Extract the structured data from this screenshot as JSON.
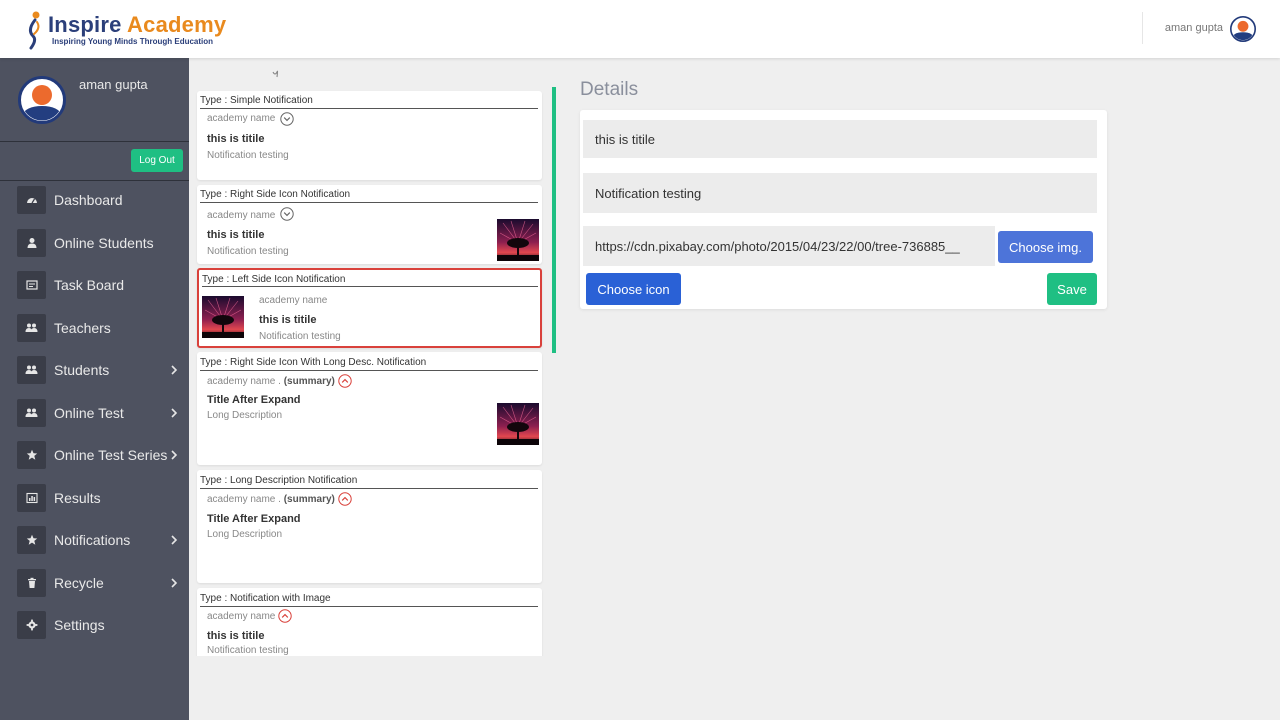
{
  "brand": {
    "name_part1": "Inspire",
    "name_part2": "Academy",
    "tagline": "Inspiring Young Minds Through Education"
  },
  "header": {
    "user_name": "aman gupta"
  },
  "sidebar": {
    "profile_name": "aman gupta",
    "logout_label": "Log Out",
    "items": [
      {
        "label": "Dashboard",
        "icon": "dashboard-icon",
        "has_submenu": false
      },
      {
        "label": "Online Students",
        "icon": "user-icon",
        "has_submenu": false
      },
      {
        "label": "Task Board",
        "icon": "task-icon",
        "has_submenu": false
      },
      {
        "label": "Teachers",
        "icon": "users-icon",
        "has_submenu": false
      },
      {
        "label": "Students",
        "icon": "users-icon",
        "has_submenu": true
      },
      {
        "label": "Online Test",
        "icon": "users-icon",
        "has_submenu": true
      },
      {
        "label": "Online Test Series",
        "icon": "star-icon",
        "has_submenu": true
      },
      {
        "label": "Results",
        "icon": "chart-icon",
        "has_submenu": false
      },
      {
        "label": "Notifications",
        "icon": "star-icon",
        "has_submenu": true
      },
      {
        "label": "Recycle",
        "icon": "trash-icon",
        "has_submenu": true
      },
      {
        "label": "Settings",
        "icon": "gear-icon",
        "has_submenu": false
      }
    ]
  },
  "notifications": [
    {
      "type": "Type : Simple Notification",
      "academy": "academy name",
      "title": "this is titile",
      "desc": "Notification testing"
    },
    {
      "type": "Type : Right Side Icon Notification",
      "academy": "academy name",
      "title": "this is titile",
      "desc": "Notification testing"
    },
    {
      "type": "Type : Left Side Icon Notification",
      "academy": "academy name",
      "title": "this is titile",
      "desc": "Notification testing"
    },
    {
      "type": "Type : Right Side Icon With Long Desc. Notification",
      "academy": "academy name .",
      "summary": "(summary)",
      "title": "Title After Expand",
      "desc": "Long Description"
    },
    {
      "type": "Type : Long Description Notification",
      "academy": "academy name .",
      "summary": "(summary)",
      "title": "Title After Expand",
      "desc": "Long Description"
    },
    {
      "type": "Type : Notification with Image",
      "academy": "academy name",
      "title": "this is titile",
      "desc": "Notification testing"
    }
  ],
  "details": {
    "heading": "Details",
    "title_value": "this is titile",
    "desc_value": "Notification testing",
    "image_url": "https://cdn.pixabay.com/photo/2015/04/23/22/00/tree-736885__",
    "choose_img_label": "Choose img.",
    "choose_icon_label": "Choose icon",
    "save_label": "Save"
  },
  "colors": {
    "sidebar_bg": "#4e5260",
    "accent_green": "#1fbf83",
    "accent_blue": "#2a61d6",
    "selected_border": "#d9413b",
    "brand_navy": "#2b3f7a",
    "brand_orange": "#e98a1e"
  }
}
